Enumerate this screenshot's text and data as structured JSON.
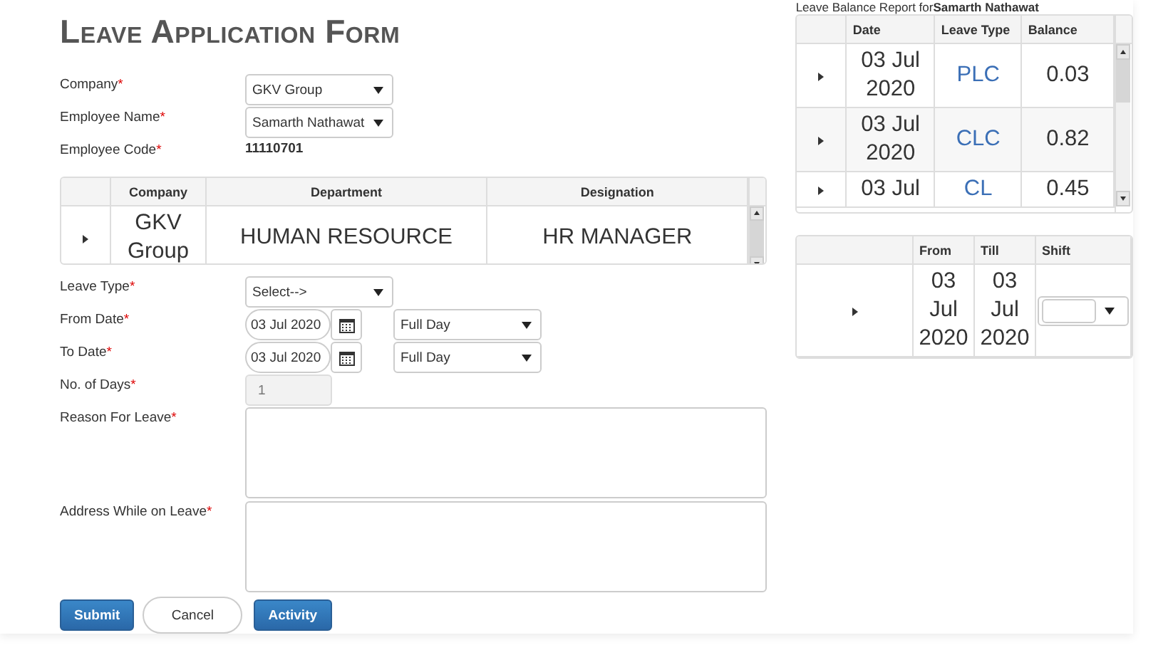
{
  "title": "Leave Application Form",
  "required_mark": "*",
  "top_fields": [
    {
      "kind": "select",
      "label": "Company",
      "required": true,
      "value": "GKV Group"
    },
    {
      "kind": "select",
      "label": "Employee Name",
      "required": true,
      "value": "Samarth Nathawat"
    },
    {
      "kind": "text",
      "label": "Employee Code",
      "required": true,
      "value": "11110701"
    }
  ],
  "employee_table": {
    "columns": [
      "Company",
      "Department",
      "Designation"
    ],
    "rows": [
      [
        "GKV Group",
        "HUMAN RESOURCE",
        "HR MANAGER"
      ]
    ]
  },
  "leave_fields": [
    {
      "kind": "select",
      "label": "Leave Type",
      "required": true,
      "value": "Select-->"
    },
    {
      "kind": "date",
      "label": "From Date",
      "required": true,
      "value": "03 Jul 2020",
      "shift": "Full Day"
    },
    {
      "kind": "date",
      "label": "To Date",
      "required": true,
      "value": "03 Jul 2020",
      "shift": "Full Day"
    },
    {
      "kind": "readonly",
      "label": "No. of Days",
      "required": true,
      "value": "1"
    },
    {
      "kind": "textarea",
      "label": "Reason For Leave",
      "required": true
    },
    {
      "kind": "textarea",
      "label": "Address While on Leave",
      "required": true
    }
  ],
  "buttons": [
    {
      "label": "Submit",
      "kind": "primary"
    },
    {
      "label": "Cancel",
      "kind": "plain"
    },
    {
      "label": "Activity",
      "kind": "primary"
    }
  ],
  "balance_report": {
    "caption": "Leave Balance Report for",
    "employee": "Samarth Nathawat",
    "columns": [
      "Date",
      "Leave Type",
      "Balance"
    ],
    "rows": [
      {
        "date": "03 Jul 2020",
        "type": "PLC",
        "balance": "0.03"
      },
      {
        "date": "03 Jul 2020",
        "type": "CLC",
        "balance": "0.82"
      },
      {
        "date": "03 Jul",
        "type": "CL",
        "balance": "0.45"
      }
    ]
  },
  "shift_table": {
    "columns": [
      "From",
      "Till",
      "Shift"
    ],
    "rows": [
      {
        "from": "03 Jul 2020",
        "till": "03 Jul 2020",
        "shift": ""
      }
    ]
  }
}
